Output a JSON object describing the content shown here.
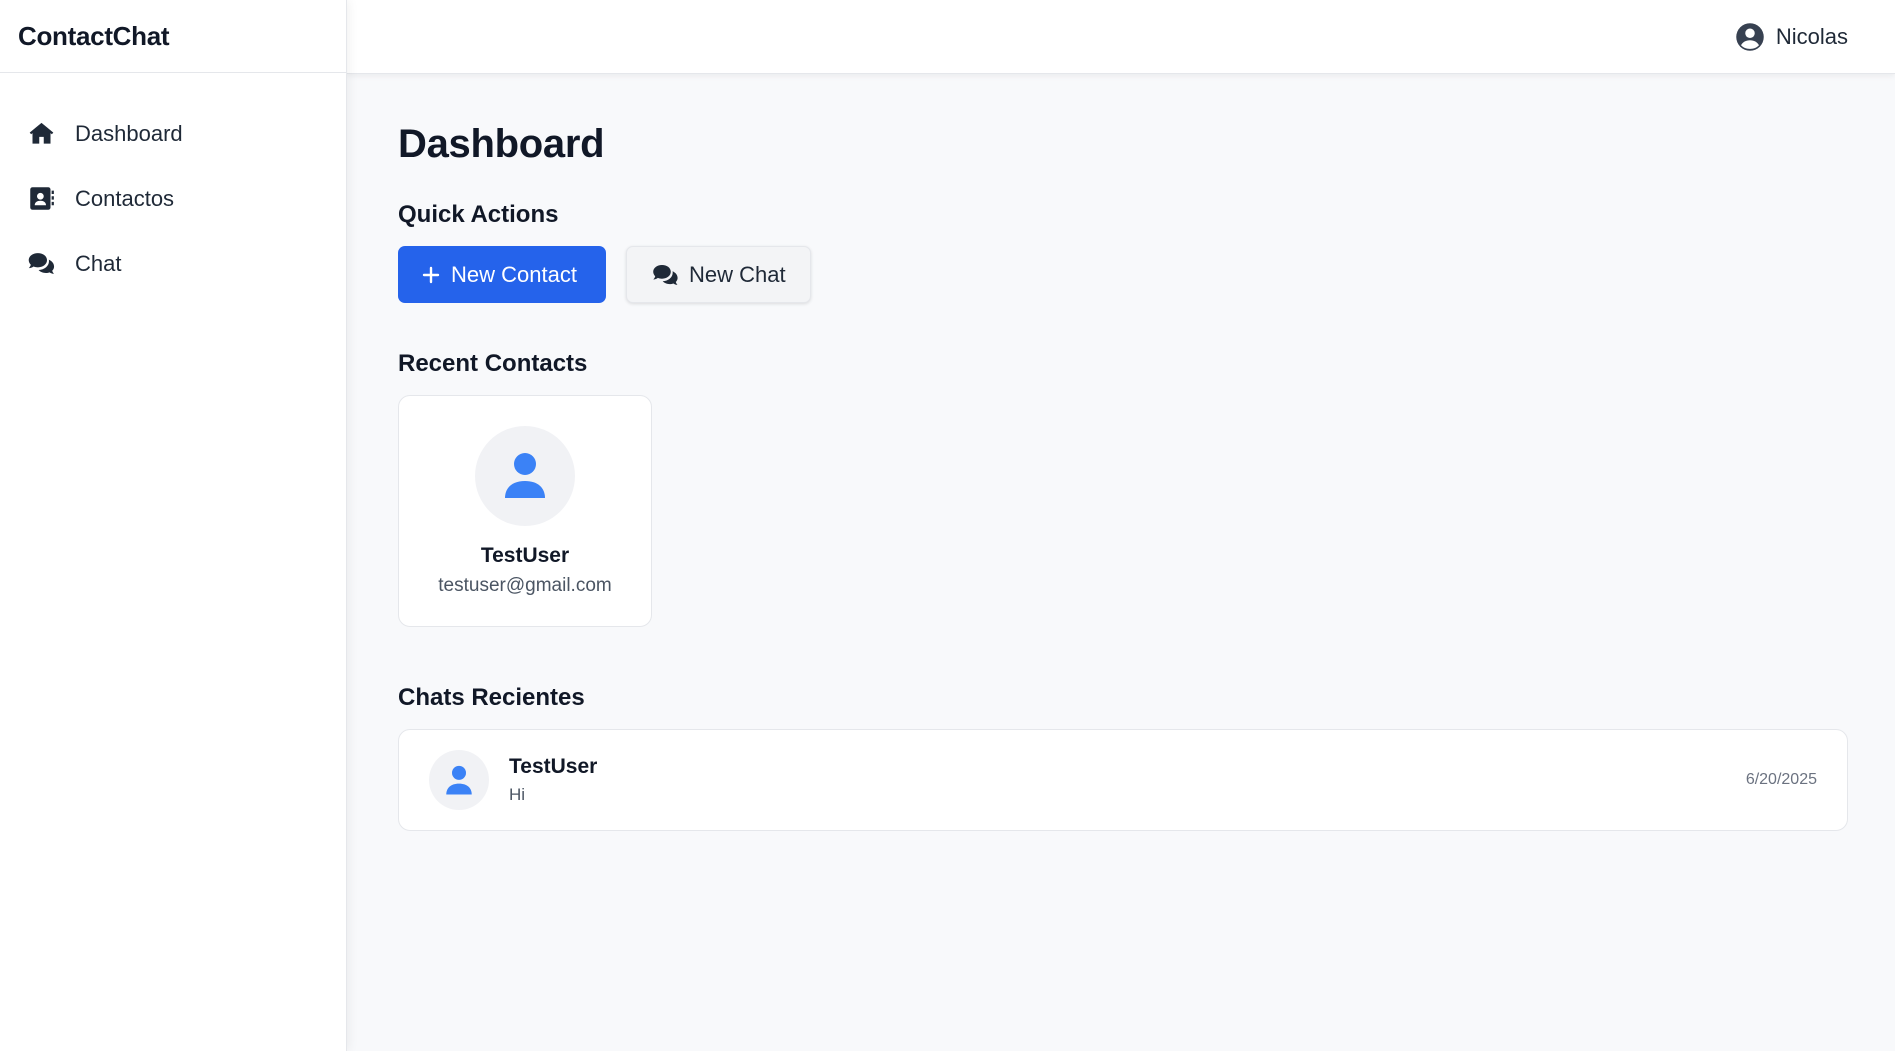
{
  "brand": {
    "name": "ContactChat"
  },
  "sidebar": {
    "items": [
      {
        "label": "Dashboard",
        "icon": "home-icon"
      },
      {
        "label": "Contactos",
        "icon": "address-book-icon"
      },
      {
        "label": "Chat",
        "icon": "comments-icon"
      }
    ]
  },
  "header": {
    "user_name": "Nicolas",
    "user_icon": "user-circle-icon"
  },
  "main": {
    "title": "Dashboard",
    "quick_actions": {
      "title": "Quick Actions",
      "new_contact_label": "New Contact",
      "new_chat_label": "New Chat"
    },
    "recent_contacts": {
      "title": "Recent Contacts",
      "items": [
        {
          "name": "TestUser",
          "email": "testuser@gmail.com"
        }
      ]
    },
    "recent_chats": {
      "title": "Chats Recientes",
      "items": [
        {
          "name": "TestUser",
          "last_message": "Hi",
          "date": "6/20/2025"
        }
      ]
    }
  },
  "colors": {
    "primary": "#2563eb",
    "avatar_icon": "#3b82f6",
    "background": "#f8f9fb",
    "text": "#111827"
  }
}
